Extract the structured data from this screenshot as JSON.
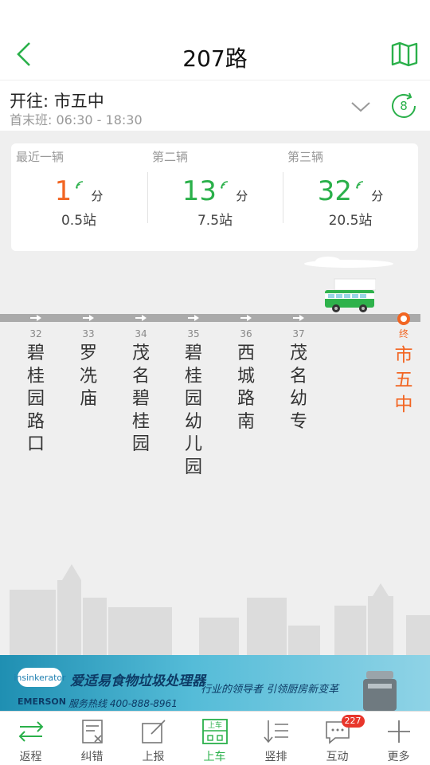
{
  "header": {
    "title": "207路"
  },
  "route_info": {
    "direction": "开往: 市五中",
    "first_last": "首末班: 06:30 - 18:30",
    "refresh_countdown": "8"
  },
  "arrivals": [
    {
      "label": "最近一辆",
      "minutes": "1",
      "unit": "分",
      "stops": "0.5站"
    },
    {
      "label": "第二辆",
      "minutes": "13",
      "unit": "分",
      "stops": "7.5站"
    },
    {
      "label": "第三辆",
      "minutes": "32",
      "unit": "分",
      "stops": "20.5站"
    }
  ],
  "stops": [
    {
      "num": "32",
      "name": "碧桂园路口"
    },
    {
      "num": "33",
      "name": "罗冼庙"
    },
    {
      "num": "34",
      "name": "茂名碧桂园"
    },
    {
      "num": "35",
      "name": "碧桂园幼儿园"
    },
    {
      "num": "36",
      "name": "西城路南"
    },
    {
      "num": "37",
      "name": "茂名幼专"
    }
  ],
  "terminal": {
    "label": "终",
    "name": "市五中"
  },
  "ad": {
    "logo_text": "insinkerator",
    "title": "爱适易食物垃圾处理器",
    "slogan": "行业的领导者 引领厨房新变革",
    "brand": "EMERSON",
    "hotline": "服务热线 400-888-8961"
  },
  "bottom_nav": [
    {
      "label": "返程",
      "icon": "swap-icon"
    },
    {
      "label": "纠错",
      "icon": "correction-icon"
    },
    {
      "label": "上报",
      "icon": "report-icon"
    },
    {
      "label": "上车",
      "icon": "board-icon",
      "icon_text": "上车",
      "active": true
    },
    {
      "label": "竖排",
      "icon": "vertical-list-icon"
    },
    {
      "label": "互动",
      "icon": "chat-icon",
      "badge": "227"
    },
    {
      "label": "更多",
      "icon": "plus-icon"
    }
  ],
  "colors": {
    "accent": "#2ab04a",
    "near": "#f26522",
    "badge": "#e8362b"
  }
}
